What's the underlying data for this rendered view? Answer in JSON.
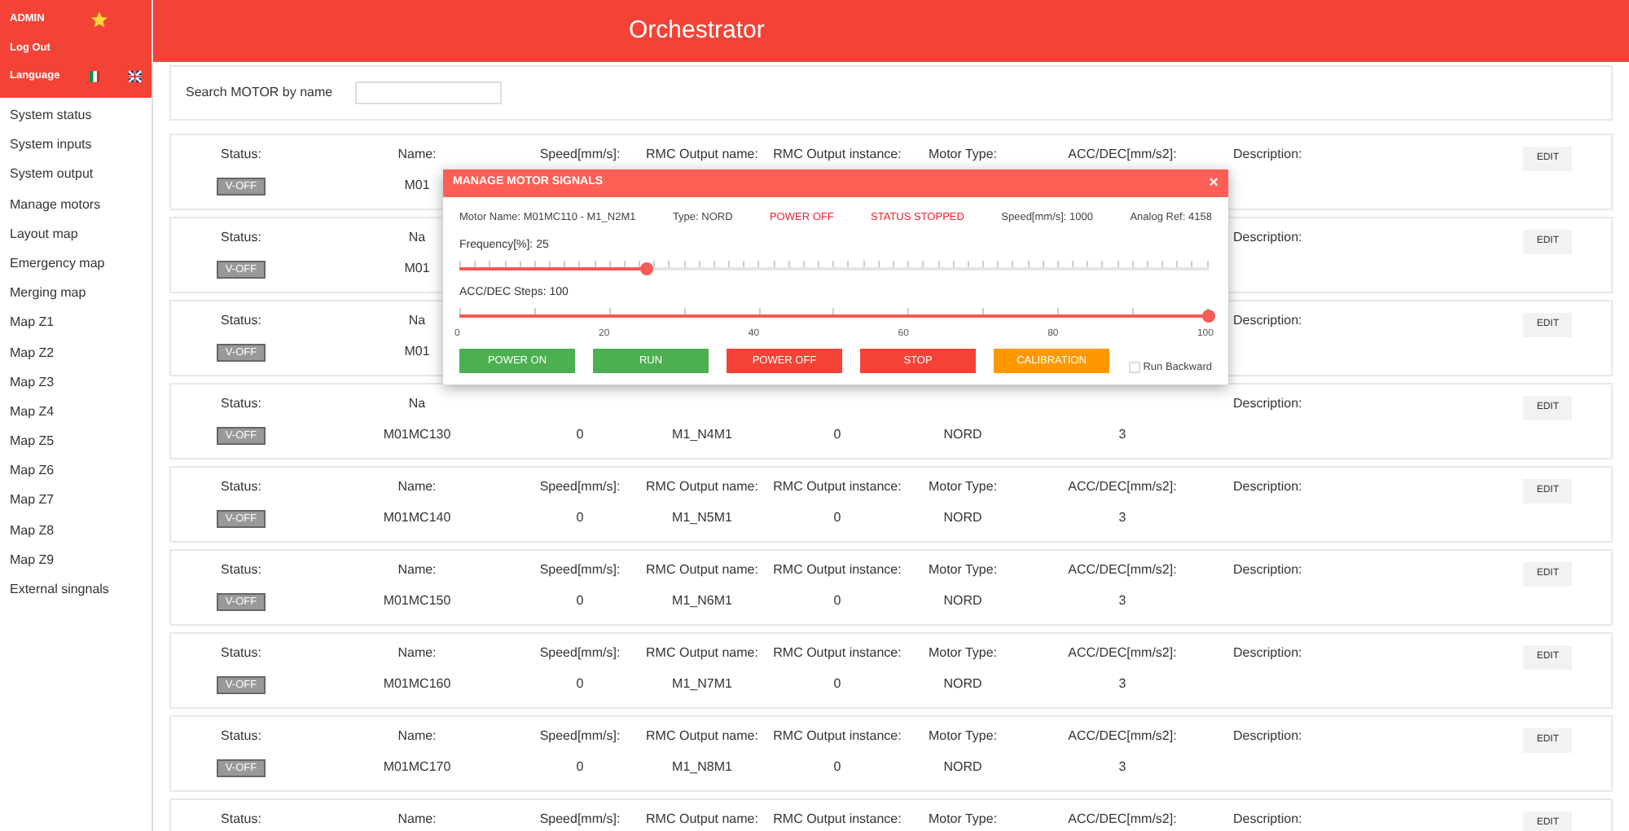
{
  "app_title": "Orchestrator",
  "user": {
    "name": "ADMIN",
    "logout": "Log Out",
    "language": "Language"
  },
  "sidebar": {
    "items": [
      {
        "label": "System status"
      },
      {
        "label": "System inputs"
      },
      {
        "label": "System output"
      },
      {
        "label": "Manage motors"
      },
      {
        "label": "Layout map"
      },
      {
        "label": "Emergency map"
      },
      {
        "label": "Merging map"
      },
      {
        "label": "Map Z1"
      },
      {
        "label": "Map Z2"
      },
      {
        "label": "Map Z3"
      },
      {
        "label": "Map Z4"
      },
      {
        "label": "Map Z5"
      },
      {
        "label": "Map Z6"
      },
      {
        "label": "Map Z7"
      },
      {
        "label": "Map Z8"
      },
      {
        "label": "Map Z9"
      },
      {
        "label": "External singnals"
      }
    ]
  },
  "search": {
    "label": "Search MOTOR by name"
  },
  "rows": [
    {
      "status": "V-OFF",
      "edit": "EDIT",
      "cells": [
        {
          "label": "Status:"
        },
        {
          "label": "Name:",
          "value": "M01"
        },
        {
          "label": "Speed[mm/s]:"
        },
        {
          "label": "RMC Output name:"
        },
        {
          "label": "RMC Output instance:"
        },
        {
          "label": "Motor Type:"
        },
        {
          "label": "ACC/DEC[mm/s2]:"
        },
        {
          "label": "Description:"
        }
      ]
    },
    {
      "status": "V-OFF",
      "edit": "EDIT",
      "cells": [
        {
          "label": "Status:"
        },
        {
          "label": "Na",
          "value": "M01"
        },
        {},
        {},
        {},
        {},
        {},
        {
          "label": "Description:"
        }
      ]
    },
    {
      "status": "V-OFF",
      "edit": "EDIT",
      "cells": [
        {
          "label": "Status:"
        },
        {
          "label": "Na",
          "value": "M01"
        },
        {},
        {},
        {},
        {},
        {},
        {
          "label": "Description:"
        }
      ]
    },
    {
      "status": "V-OFF",
      "edit": "EDIT",
      "cells": [
        {
          "label": "Status:"
        },
        {
          "label": "Na",
          "value": "M01MC130"
        },
        {
          "value": "0"
        },
        {
          "value": "M1_N4M1"
        },
        {
          "value": "0"
        },
        {
          "value": "NORD"
        },
        {
          "value": "3"
        },
        {
          "label": "Description:"
        }
      ]
    },
    {
      "status": "V-OFF",
      "edit": "EDIT",
      "cells": [
        {
          "label": "Status:"
        },
        {
          "label": "Name:",
          "value": "M01MC140"
        },
        {
          "label": "Speed[mm/s]:",
          "value": "0"
        },
        {
          "label": "RMC Output name:",
          "value": "M1_N5M1"
        },
        {
          "label": "RMC Output instance:",
          "value": "0"
        },
        {
          "label": "Motor Type:",
          "value": "NORD"
        },
        {
          "label": "ACC/DEC[mm/s2]:",
          "value": "3"
        },
        {
          "label": "Description:"
        }
      ]
    },
    {
      "status": "V-OFF",
      "edit": "EDIT",
      "cells": [
        {
          "label": "Status:"
        },
        {
          "label": "Name:",
          "value": "M01MC150"
        },
        {
          "label": "Speed[mm/s]:",
          "value": "0"
        },
        {
          "label": "RMC Output name:",
          "value": "M1_N6M1"
        },
        {
          "label": "RMC Output instance:",
          "value": "0"
        },
        {
          "label": "Motor Type:",
          "value": "NORD"
        },
        {
          "label": "ACC/DEC[mm/s2]:",
          "value": "3"
        },
        {
          "label": "Description:"
        }
      ]
    },
    {
      "status": "V-OFF",
      "edit": "EDIT",
      "cells": [
        {
          "label": "Status:"
        },
        {
          "label": "Name:",
          "value": "M01MC160"
        },
        {
          "label": "Speed[mm/s]:",
          "value": "0"
        },
        {
          "label": "RMC Output name:",
          "value": "M1_N7M1"
        },
        {
          "label": "RMC Output instance:",
          "value": "0"
        },
        {
          "label": "Motor Type:",
          "value": "NORD"
        },
        {
          "label": "ACC/DEC[mm/s2]:",
          "value": "3"
        },
        {
          "label": "Description:"
        }
      ]
    },
    {
      "status": "V-OFF",
      "edit": "EDIT",
      "cells": [
        {
          "label": "Status:"
        },
        {
          "label": "Name:",
          "value": "M01MC170"
        },
        {
          "label": "Speed[mm/s]:",
          "value": "0"
        },
        {
          "label": "RMC Output name:",
          "value": "M1_N8M1"
        },
        {
          "label": "RMC Output instance:",
          "value": "0"
        },
        {
          "label": "Motor Type:",
          "value": "NORD"
        },
        {
          "label": "ACC/DEC[mm/s2]:",
          "value": "3"
        },
        {
          "label": "Description:"
        }
      ]
    },
    {
      "edit": "EDIT",
      "cells": [
        {
          "label": "Status:"
        },
        {
          "label": "Name:"
        },
        {
          "label": "Speed[mm/s]:"
        },
        {
          "label": "RMC Output name:"
        },
        {
          "label": "RMC Output instance:"
        },
        {
          "label": "Motor Type:"
        },
        {
          "label": "ACC/DEC[mm/s2]:"
        },
        {
          "label": "Description:"
        }
      ]
    }
  ],
  "modal": {
    "title": "MANAGE MOTOR SIGNALS",
    "close": "×",
    "info": [
      {
        "text": "Motor Name: M01MC110 - M1_N2M1",
        "kind": "plain"
      },
      {
        "text": "Type: NORD",
        "kind": "plain"
      },
      {
        "text": "POWER OFF",
        "kind": "alert"
      },
      {
        "text": "STATUS STOPPED",
        "kind": "alert"
      },
      {
        "text": "Speed[mm/s]: 1000",
        "kind": "plain"
      },
      {
        "text": "Analog Ref: 4158",
        "kind": "plain"
      }
    ],
    "sliders": [
      {
        "label": "Frequency[%]: 25",
        "level": 0.25
      },
      {
        "label": "ACC/DEC Steps: 100",
        "level": 1.0,
        "scale": [
          "0",
          "20",
          "40",
          "60",
          "80",
          "100"
        ]
      }
    ],
    "buttons": [
      {
        "label": "POWER ON",
        "color": "#4caf50"
      },
      {
        "label": "RUN",
        "color": "#4caf50"
      },
      {
        "label": "POWER OFF",
        "color": "#f44336"
      },
      {
        "label": "STOP",
        "color": "#f44336"
      },
      {
        "label": "CALIBRATION",
        "color": "#ff9800"
      }
    ],
    "run_backward": {
      "label": "Run Backward",
      "checked": false
    }
  }
}
